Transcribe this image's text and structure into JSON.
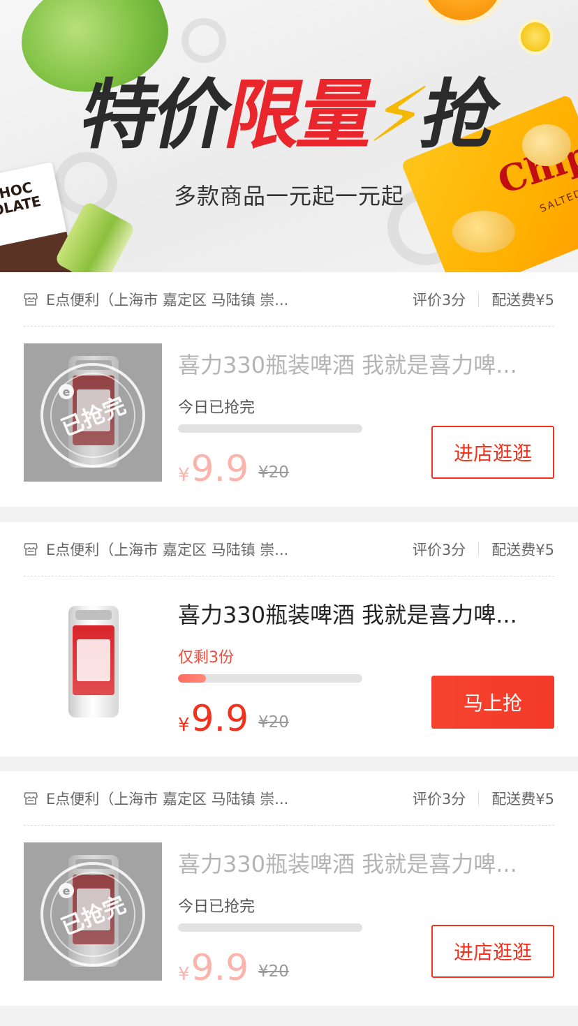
{
  "banner": {
    "title_black_1": "特价",
    "title_red": "限量",
    "title_black_2": "抢",
    "subtitle": "多款商品一元起一元起",
    "decor_choc_text": "CHOC OLATE",
    "decor_chips_text": "Chips",
    "decor_chips_sub": "SALTED"
  },
  "cards": [
    {
      "store": "E点便利（上海市 嘉定区 马陆镇 崇...",
      "rating": "评价3分",
      "fee": "配送费¥5",
      "product": "喜力330瓶装啤酒 我就是喜力啤...",
      "stock_text": "今日已抢完",
      "progress": 0,
      "stamp": "已抢完",
      "currency": "¥",
      "price": "9.9",
      "orig_price": "¥20",
      "button": "进店逛逛",
      "state": "soldout"
    },
    {
      "store": "E点便利（上海市 嘉定区 马陆镇 崇...",
      "rating": "评价3分",
      "fee": "配送费¥5",
      "product": "喜力330瓶装啤酒 我就是喜力啤...",
      "stock_text": "仅剩3份",
      "progress": 0.15,
      "currency": "¥",
      "price": "9.9",
      "orig_price": "¥20",
      "button": "马上抢",
      "state": "available"
    },
    {
      "store": "E点便利（上海市 嘉定区 马陆镇 崇...",
      "rating": "评价3分",
      "fee": "配送费¥5",
      "product": "喜力330瓶装啤酒 我就是喜力啤...",
      "stock_text": "今日已抢完",
      "progress": 0,
      "stamp": "已抢完",
      "currency": "¥",
      "price": "9.9",
      "orig_price": "¥20",
      "button": "进店逛逛",
      "state": "soldout"
    }
  ],
  "colors": {
    "accent": "#f2321f",
    "title_red": "#e8262b",
    "progress": "#ff6a5e"
  }
}
